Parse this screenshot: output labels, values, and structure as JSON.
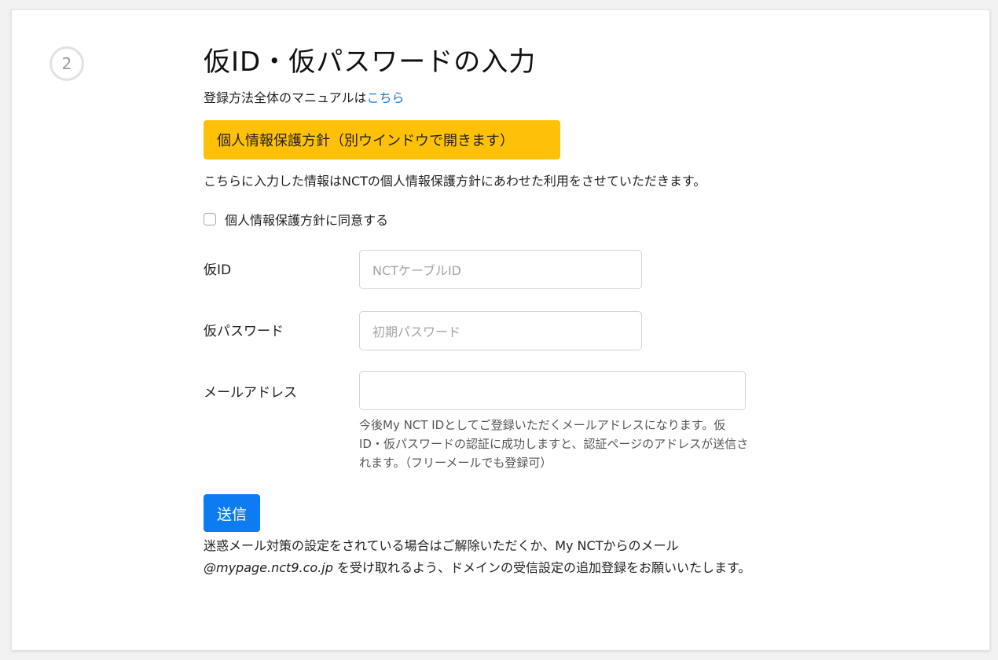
{
  "step": {
    "number": "2"
  },
  "title": "仮ID・仮パスワードの入力",
  "manual": {
    "text": "登録方法全体のマニュアルは",
    "link": "こちら"
  },
  "privacy_button": "個人情報保護方針（別ウインドウで開きます）",
  "notice": "こちらに入力した情報はNCTの個人情報保護方針にあわせた利用をさせていただきます。",
  "agree_label": "個人情報保護方針に同意する",
  "fields": {
    "temp_id": {
      "label": "仮ID",
      "placeholder": "NCTケーブルID",
      "value": ""
    },
    "temp_password": {
      "label": "仮パスワード",
      "placeholder": "初期パスワード",
      "value": ""
    },
    "email": {
      "label": "メールアドレス",
      "placeholder": "",
      "value": ""
    }
  },
  "email_help": "今後My NCT IDとしてご登録いただくメールアドレスになります。仮ID・仮パスワードの認証に成功しますと、認証ページのアドレスが送信されます。（フリーメールでも登録可）",
  "send_button": "送信",
  "spam_notice": {
    "before": "迷惑メール対策の設定をされている場合はご解除いただくか、My NCTからのメール",
    "domain": "@mypage.nct9.co.jp",
    "after": " を受け取れるよう、ドメインの受信設定の追加登録をお願いいたします。"
  },
  "colors": {
    "privacy_button_bg": "#ffc107",
    "send_button_bg": "#0d7cf2",
    "link": "#1a7ad4"
  }
}
